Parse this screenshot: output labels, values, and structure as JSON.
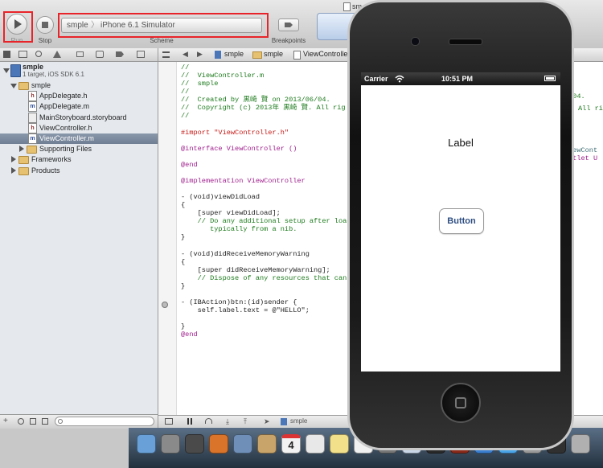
{
  "toolbar": {
    "run_label": "Run",
    "stop_label": "Stop",
    "scheme_project": "smple",
    "scheme_separator": "〉",
    "scheme_destination": "iPhone 6.1 Simulator",
    "scheme_label": "Scheme",
    "breakpoints_label": "Breakpoints",
    "window_title_fragment": "sm"
  },
  "jump_bar": {
    "items": [
      "smple",
      "smple",
      "ViewController.m"
    ]
  },
  "navigator": {
    "project_name": "smple",
    "project_subtitle": "1 target, iOS SDK 6.1",
    "items": [
      {
        "label": "smple",
        "kind": "folder",
        "indent": 1,
        "expanded": true
      },
      {
        "label": "AppDelegate.h",
        "kind": "h",
        "indent": 2
      },
      {
        "label": "AppDelegate.m",
        "kind": "m",
        "indent": 2
      },
      {
        "label": "MainStoryboard.storyboard",
        "kind": "sb",
        "indent": 2
      },
      {
        "label": "ViewController.h",
        "kind": "h",
        "indent": 2
      },
      {
        "label": "ViewController.m",
        "kind": "m",
        "indent": 2,
        "selected": true
      },
      {
        "label": "Supporting Files",
        "kind": "folder",
        "indent": 2,
        "expanded": false
      },
      {
        "label": "Frameworks",
        "kind": "folder",
        "indent": 1,
        "expanded": false
      },
      {
        "label": "Products",
        "kind": "folder",
        "indent": 1,
        "expanded": false
      }
    ]
  },
  "editor": {
    "lines": [
      {
        "t": "//",
        "c": "cm"
      },
      {
        "t": "//  ViewController.m",
        "c": "cm"
      },
      {
        "t": "//  smple",
        "c": "cm"
      },
      {
        "t": "//",
        "c": "cm"
      },
      {
        "t": "//  Created by 黒崎 賢 on 2013/06/04.",
        "c": "cm"
      },
      {
        "t": "//  Copyright (c) 2013年 黒崎 賢. All rig",
        "c": "cm"
      },
      {
        "t": "//",
        "c": "cm"
      },
      {
        "t": "",
        "c": "def"
      },
      {
        "t": "#import \"ViewController.h\"",
        "c": "str"
      },
      {
        "t": "",
        "c": "def"
      },
      {
        "t": "@interface ViewController ()",
        "c": "kw"
      },
      {
        "t": "",
        "c": "def"
      },
      {
        "t": "@end",
        "c": "kw"
      },
      {
        "t": "",
        "c": "def"
      },
      {
        "t": "@implementation ViewController",
        "c": "kw"
      },
      {
        "t": "",
        "c": "def"
      },
      {
        "t": "- (void)viewDidLoad",
        "c": "def"
      },
      {
        "t": "{",
        "c": "def"
      },
      {
        "t": "    [super viewDidLoad];",
        "c": "def"
      },
      {
        "t": "    // Do any additional setup after load",
        "c": "cm"
      },
      {
        "t": "       typically from a nib.",
        "c": "cm"
      },
      {
        "t": "}",
        "c": "def"
      },
      {
        "t": "",
        "c": "def"
      },
      {
        "t": "- (void)didReceiveMemoryWarning",
        "c": "def"
      },
      {
        "t": "{",
        "c": "def"
      },
      {
        "t": "    [super didReceiveMemoryWarning];",
        "c": "def"
      },
      {
        "t": "    // Dispose of any resources that can",
        "c": "cm"
      },
      {
        "t": "}",
        "c": "def"
      },
      {
        "t": "",
        "c": "def"
      },
      {
        "t": "- (IBAction)btn:(id)sender {",
        "c": "def"
      },
      {
        "t": "    self.label.text = @\"HELLO\";",
        "c": "def"
      },
      {
        "t": "",
        "c": "def"
      },
      {
        "t": "}",
        "c": "def"
      },
      {
        "t": "@end",
        "c": "kw"
      }
    ],
    "right_fragments": [
      "/04.",
      "All ri",
      "iewCont",
      "utlet U"
    ],
    "debug_bar_label": "smple"
  },
  "simulator": {
    "carrier": "Carrier",
    "time": "10:51 PM",
    "label_text": "Label",
    "button_text": "Button"
  },
  "dock": {
    "calendar_day": "4"
  },
  "colors": {
    "highlight_red": "#e8242a",
    "selection_blue": "#3875d7",
    "comment_green": "#1d7a1d",
    "keyword_purple": "#a0208e",
    "button_text_blue": "#2f4f82"
  }
}
